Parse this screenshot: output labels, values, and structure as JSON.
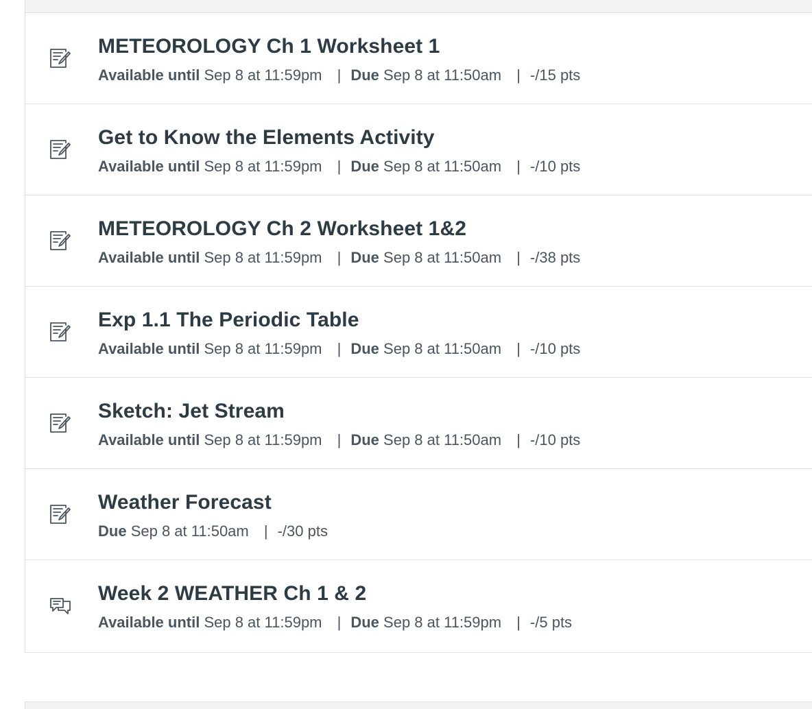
{
  "items": [
    {
      "icon": "assignment-icon",
      "title": "METEOROLOGY Ch 1 Worksheet 1",
      "available_label": "Available until",
      "available_value": "Sep 8 at 11:59pm",
      "due_label": "Due",
      "due_value": "Sep 8 at 11:50am",
      "points": "-/15 pts"
    },
    {
      "icon": "assignment-icon",
      "title": "Get to Know the Elements Activity",
      "available_label": "Available until",
      "available_value": "Sep 8 at 11:59pm",
      "due_label": "Due",
      "due_value": "Sep 8 at 11:50am",
      "points": "-/10 pts"
    },
    {
      "icon": "assignment-icon",
      "title": "METEOROLOGY Ch 2 Worksheet 1&2",
      "available_label": "Available until",
      "available_value": "Sep 8 at 11:59pm",
      "due_label": "Due",
      "due_value": "Sep 8 at 11:50am",
      "points": "-/38 pts"
    },
    {
      "icon": "assignment-icon",
      "title": "Exp 1.1 The Periodic Table",
      "available_label": "Available until",
      "available_value": "Sep 8 at 11:59pm",
      "due_label": "Due",
      "due_value": "Sep 8 at 11:50am",
      "points": "-/10 pts"
    },
    {
      "icon": "assignment-icon",
      "title": "Sketch: Jet Stream",
      "available_label": "Available until",
      "available_value": "Sep 8 at 11:59pm",
      "due_label": "Due",
      "due_value": "Sep 8 at 11:50am",
      "points": "-/10 pts"
    },
    {
      "icon": "assignment-icon",
      "title": "Weather Forecast",
      "due_label": "Due",
      "due_value": "Sep 8 at 11:50am",
      "points": "-/30 pts"
    },
    {
      "icon": "discussion-icon",
      "title": "Week 2 WEATHER Ch 1 & 2",
      "available_label": "Available until",
      "available_value": "Sep 8 at 11:59pm",
      "due_label": "Due",
      "due_value": "Sep 8 at 11:59pm",
      "points": "-/5 pts"
    }
  ],
  "separator": "|"
}
